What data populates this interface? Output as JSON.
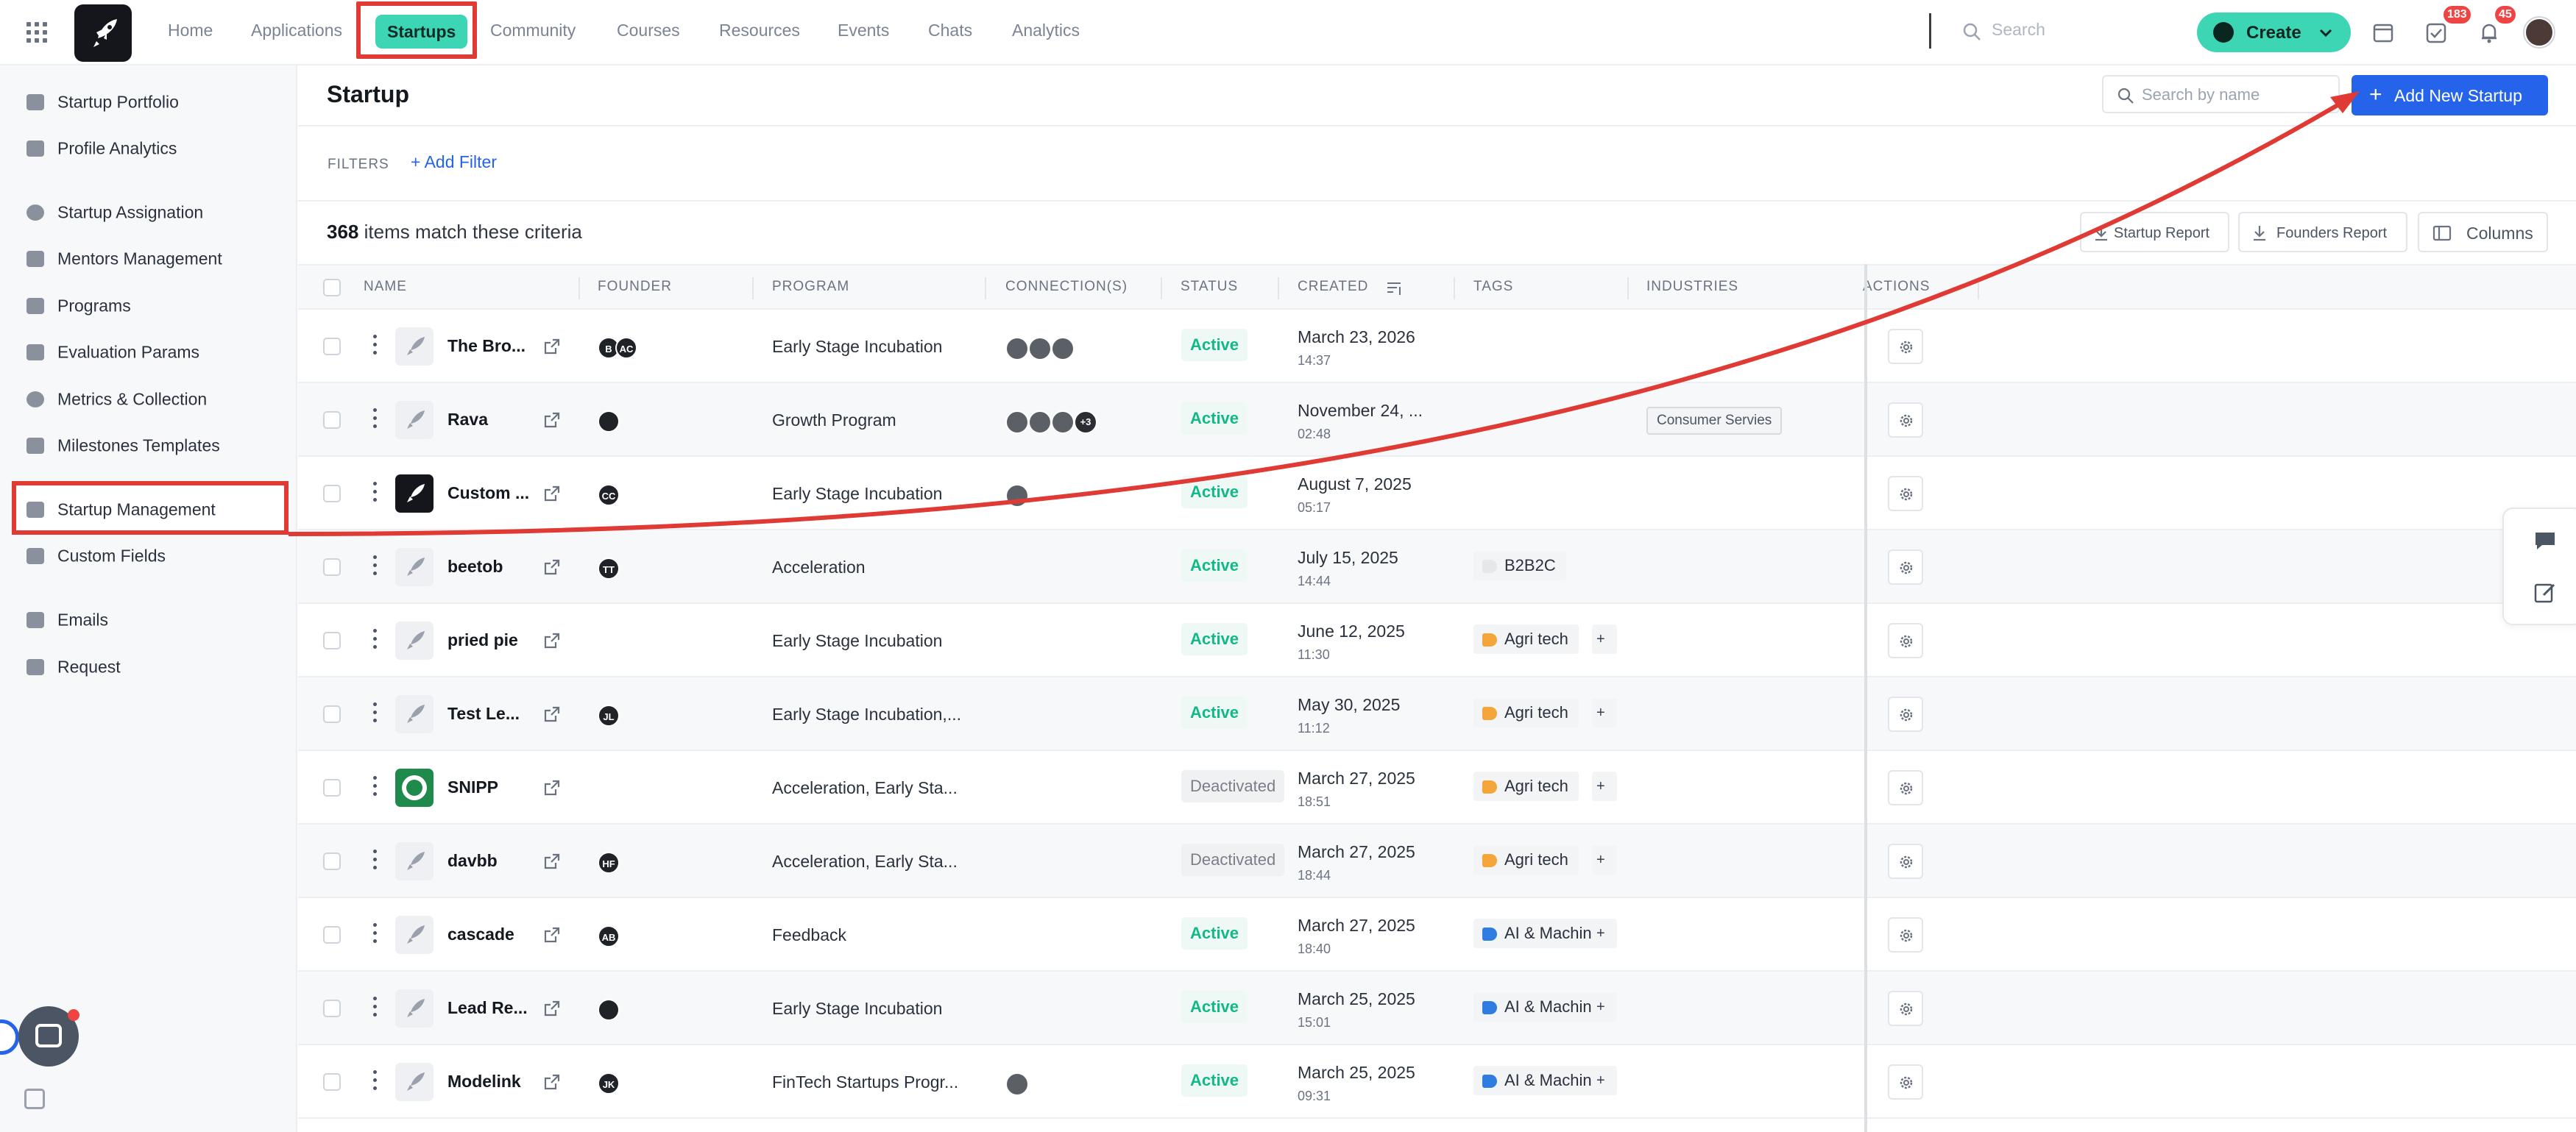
{
  "nav": {
    "items": [
      "Home",
      "Applications",
      "Startups",
      "Community",
      "Courses",
      "Resources",
      "Events",
      "Chats",
      "Analytics"
    ],
    "active": "Startups",
    "search_placeholder": "Search",
    "create_label": "Create",
    "tasks_badge": "183",
    "notifications_badge": "45"
  },
  "sidebar": {
    "items": [
      "Startup Portfolio",
      "Profile Analytics",
      "Startup Assignation",
      "Mentors Management",
      "Programs",
      "Evaluation Params",
      "Metrics & Collection",
      "Milestones Templates",
      "Startup Management",
      "Custom Fields",
      "Emails",
      "Request"
    ],
    "active": "Startup Management"
  },
  "page": {
    "title": "Startup",
    "search_placeholder": "Search by name",
    "add_button": "Add New Startup",
    "filters_label": "FILTERS",
    "add_filter": "Add Filter",
    "count": "368",
    "count_suffix": "items match these criteria",
    "startup_report": "Startup Report",
    "founders_report": "Founders Report",
    "columns": "Columns"
  },
  "table": {
    "headers": [
      "NAME",
      "FOUNDER",
      "PROGRAM",
      "CONNECTION(S)",
      "STATUS",
      "CREATED",
      "TAGS",
      "INDUSTRIES",
      "ACTIONS"
    ],
    "rows": [
      {
        "name": "The Bro...",
        "founders": [
          "B",
          "AC"
        ],
        "program": "Early Stage Incubation",
        "connections": [
          "",
          "",
          ""
        ],
        "status": "Active",
        "date": "March 23, 2026",
        "time": "14:37",
        "tag": "",
        "industry": ""
      },
      {
        "name": "Rava",
        "founders": [
          ""
        ],
        "program": "Growth Program",
        "connections": [
          "",
          "",
          "",
          "+3"
        ],
        "status": "Active",
        "date": "November 24, ...",
        "time": "02:48",
        "tag": "",
        "industry": "Consumer Servies"
      },
      {
        "name": "Custom ...",
        "founders": [
          "CC"
        ],
        "program": "Early Stage Incubation",
        "connections": [
          ""
        ],
        "status": "Active",
        "date": "August 7, 2025",
        "time": "05:17",
        "tag": "",
        "industry": ""
      },
      {
        "name": "beetob",
        "founders": [
          "TT"
        ],
        "program": "Acceleration",
        "connections": [],
        "status": "Active",
        "date": "July 15, 2025",
        "time": "14:44",
        "tag": "B2B2C",
        "industry": ""
      },
      {
        "name": "pried pie",
        "founders": [],
        "program": "Early Stage Incubation",
        "connections": [],
        "status": "Active",
        "date": "June 12, 2025",
        "time": "11:30",
        "tag": "Agri tech",
        "industry": ""
      },
      {
        "name": "Test Le...",
        "founders": [
          "JL"
        ],
        "program": "Early Stage Incubation,...",
        "connections": [],
        "status": "Active",
        "date": "May 30, 2025",
        "time": "11:12",
        "tag": "Agri tech",
        "industry": ""
      },
      {
        "name": "SNIPP",
        "founders": [],
        "program": "Acceleration, Early Sta...",
        "connections": [],
        "status": "Deactivated",
        "date": "March 27, 2025",
        "time": "18:51",
        "tag": "Agri tech",
        "industry": ""
      },
      {
        "name": "davbb",
        "founders": [
          "HF"
        ],
        "program": "Acceleration, Early Sta...",
        "connections": [],
        "status": "Deactivated",
        "date": "March 27, 2025",
        "time": "18:44",
        "tag": "Agri tech",
        "industry": ""
      },
      {
        "name": "cascade",
        "founders": [
          "AB"
        ],
        "program": "Feedback",
        "connections": [],
        "status": "Active",
        "date": "March 27, 2025",
        "time": "18:40",
        "tag": "AI & Machine",
        "industry": ""
      },
      {
        "name": "Lead Re...",
        "founders": [
          ""
        ],
        "program": "Early Stage Incubation",
        "connections": [],
        "status": "Active",
        "date": "March 25, 2025",
        "time": "15:01",
        "tag": "AI & Machine",
        "industry": ""
      },
      {
        "name": "Modelink",
        "founders": [
          "JK"
        ],
        "program": "FinTech Startups Progr...",
        "connections": [
          ""
        ],
        "status": "Active",
        "date": "March 25, 2025",
        "time": "09:31",
        "tag": "AI & Machine",
        "industry": ""
      }
    ]
  },
  "colors": {
    "accent": "#3dd6b5",
    "primary": "#2563eb",
    "annotation": "#e03a35",
    "active_status": "#12b886"
  }
}
